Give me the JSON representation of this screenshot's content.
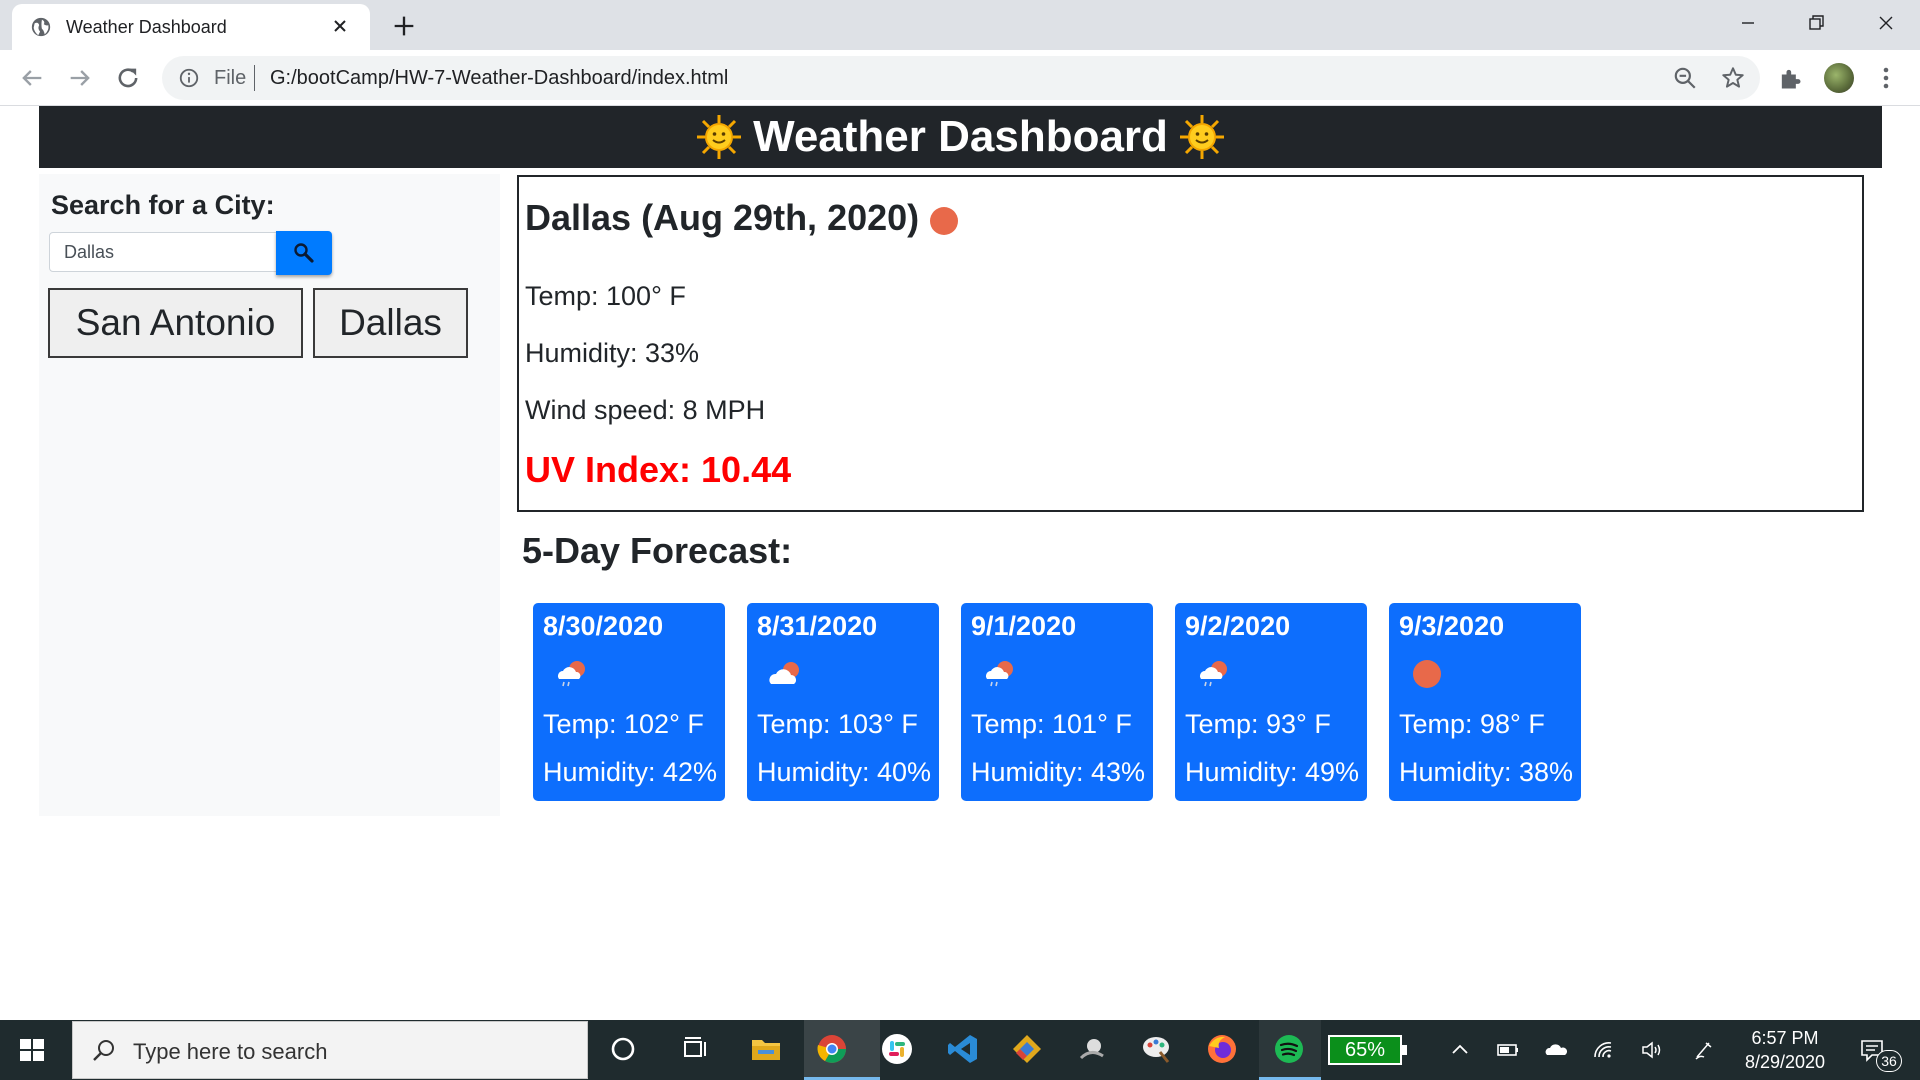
{
  "browser": {
    "tab_title": "Weather Dashboard",
    "omnibox_scheme": "File",
    "url": "G:/bootCamp/HW-7-Weather-Dashboard/index.html"
  },
  "page": {
    "header_title": "Weather Dashboard",
    "search": {
      "label": "Search for a City:",
      "value": "Dallas"
    },
    "history": [
      "San Antonio",
      "Dallas"
    ],
    "current": {
      "title": "Dallas (Aug 29th, 2020)",
      "icon": "sun-icon",
      "temp": "Temp: 100° F",
      "humidity": "Humidity: 33%",
      "wind": "Wind speed: 8 MPH",
      "uv": "UV Index: 10.44",
      "uv_color": "#ff0000"
    },
    "forecast_heading": "5-Day Forecast:",
    "forecast": [
      {
        "date": "8/30/2020",
        "icon": "cloud-rain-sun-icon",
        "temp": "Temp: 102° F",
        "humidity": "Humidity: 42%"
      },
      {
        "date": "8/31/2020",
        "icon": "cloud-sun-icon",
        "temp": "Temp: 103° F",
        "humidity": "Humidity: 40%"
      },
      {
        "date": "9/1/2020",
        "icon": "cloud-rain-sun-icon",
        "temp": "Temp: 101° F",
        "humidity": "Humidity: 43%"
      },
      {
        "date": "9/2/2020",
        "icon": "cloud-rain-sun-icon",
        "temp": "Temp: 93° F",
        "humidity": "Humidity: 49%"
      },
      {
        "date": "9/3/2020",
        "icon": "sun-icon",
        "temp": "Temp: 98° F",
        "humidity": "Humidity: 38%"
      }
    ],
    "colors": {
      "header_bg": "#212529",
      "card_bg": "#0d6efd",
      "search_button": "#007bff",
      "sun": "#e8694a"
    }
  },
  "taskbar": {
    "search_placeholder": "Type here to search",
    "battery": "65%",
    "time": "6:57 PM",
    "date": "8/29/2020",
    "notification_count": "36"
  }
}
